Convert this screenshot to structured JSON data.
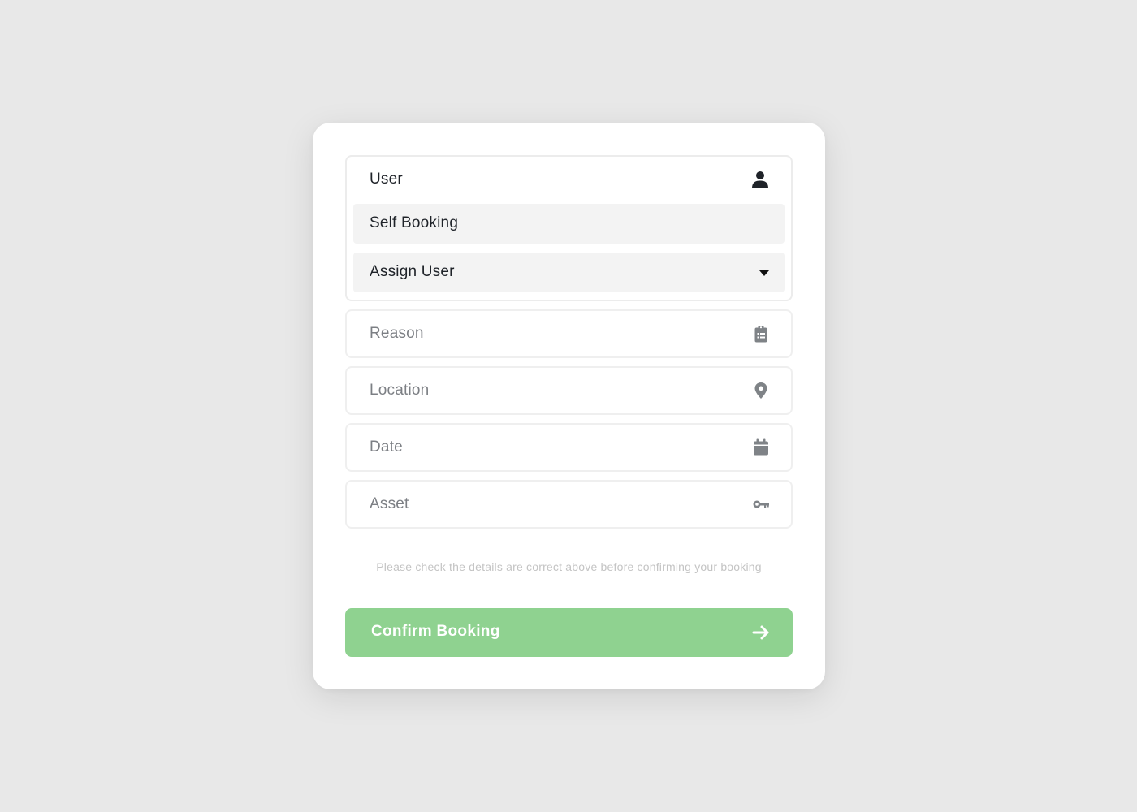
{
  "user_group": {
    "label": "User",
    "icon": "user-icon",
    "options": [
      {
        "label": "Self Booking"
      },
      {
        "label": "Assign User",
        "icon": "caret-down-icon"
      }
    ]
  },
  "fields": {
    "reason": {
      "placeholder": "Reason",
      "icon": "clipboard-list-icon"
    },
    "location": {
      "placeholder": "Location",
      "icon": "map-marker-icon"
    },
    "date": {
      "placeholder": "Date",
      "icon": "calendar-icon"
    },
    "asset": {
      "placeholder": "Asset",
      "icon": "key-icon"
    }
  },
  "note": "Please check the details are correct above before confirming your booking",
  "confirm": {
    "label": "Confirm Booking",
    "icon": "arrow-right-icon"
  },
  "colors": {
    "background": "#e8e8e8",
    "card": "#ffffff",
    "accent_green": "#8fd290",
    "text_dark": "#1f2329",
    "text_placeholder": "#7c7f84",
    "icon_grey": "#7f8387"
  }
}
